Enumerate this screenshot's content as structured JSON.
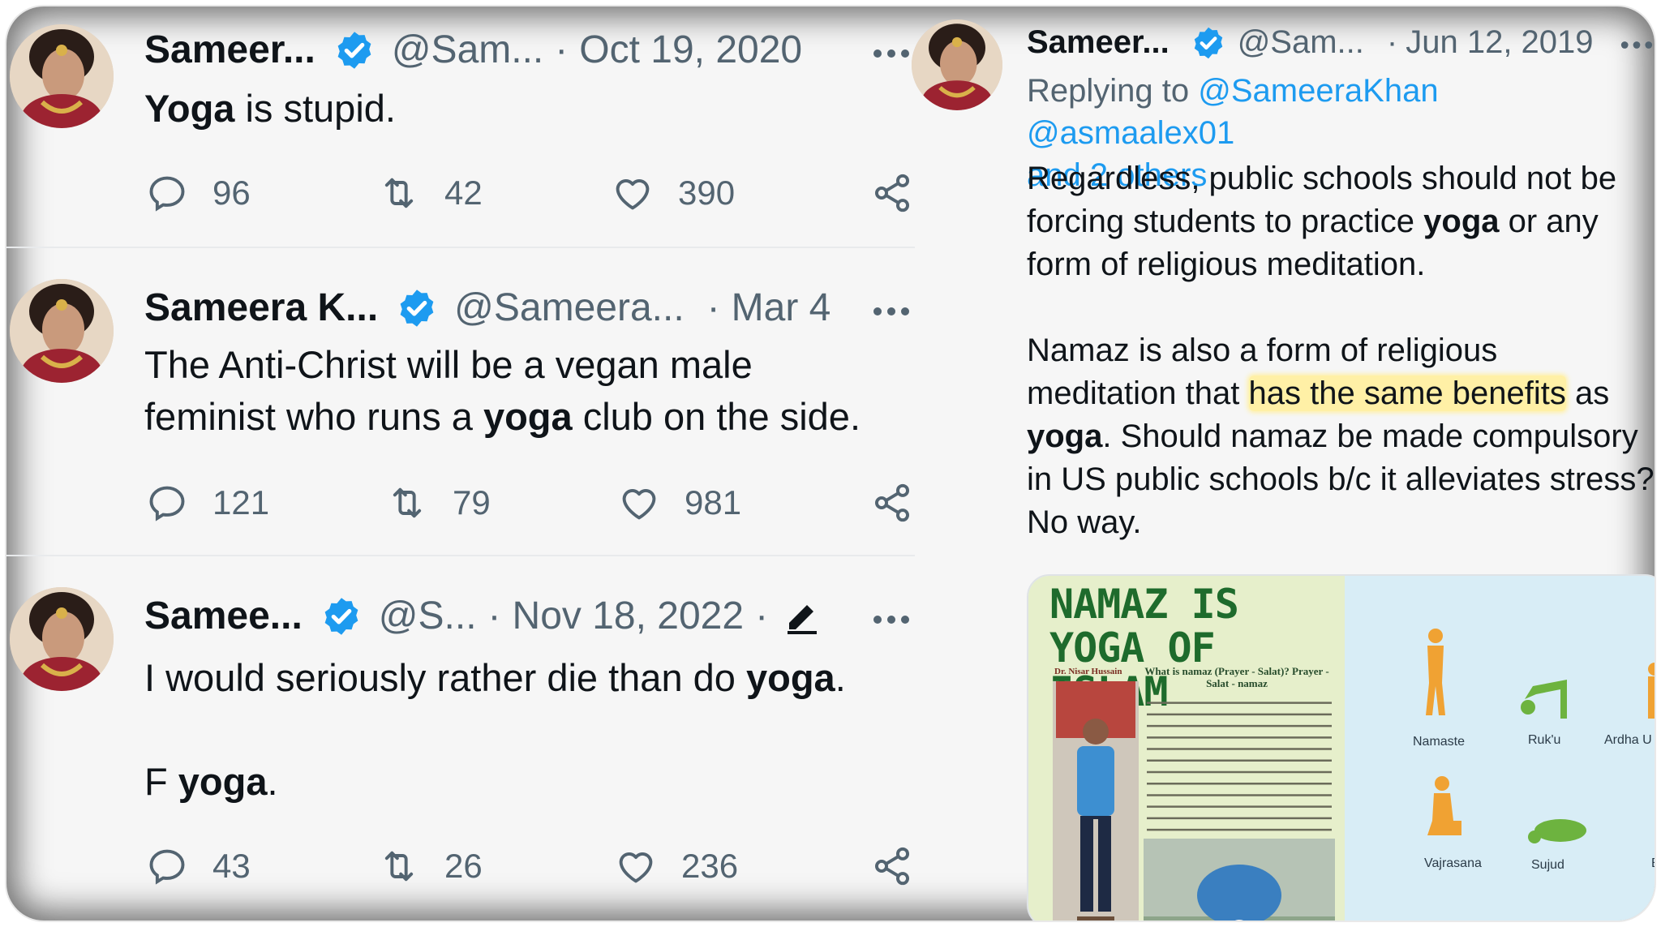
{
  "left_tweets": [
    {
      "name": "Sameer...",
      "handle": "@Sam...",
      "date": "Oct 19, 2020",
      "text_bold": "Yoga",
      "text_rest": " is stupid.",
      "replies": "96",
      "retweets": "42",
      "likes": "390"
    },
    {
      "name": "Sameera K...",
      "handle": "@Sameera...",
      "date": "Mar 4",
      "line1": "The Anti-Christ will be a vegan male",
      "line2_pre": "feminist who runs a ",
      "line2_bold": "yoga",
      "line2_post": " club on the side.",
      "replies": "121",
      "retweets": "79",
      "likes": "981"
    },
    {
      "name": "Samee...",
      "handle": "@S...",
      "date": "Nov 18, 2022",
      "line1_pre": "I would seriously rather die than do ",
      "line1_bold": "yoga",
      "line1_post": ".",
      "line2_pre": "F ",
      "line2_bold": "yoga",
      "line2_post": ".",
      "replies": "43",
      "retweets": "26",
      "likes": "236"
    }
  ],
  "right_tweet": {
    "name": "Sameer...",
    "handle": "@Sam...",
    "date": "Jun 12, 2019",
    "replying_prefix": "Replying to ",
    "mention1": "@SameeraKhan",
    "mention2": "@asmaalex01",
    "others": "and 2 others",
    "p1_l1": "Regardless, public schools should not be",
    "p1_l2_pre": "forcing students to practice ",
    "p1_l2_bold": "yoga",
    "p1_l2_post": " or any",
    "p1_l3": "form of religious meditation.",
    "p2_l1": "Namaz is also a form of religious",
    "p2_l2_pre": "meditation that ",
    "p2_l2_hl": "has the same benefits",
    "p2_l2_post": " as",
    "p2_l3_bold": "yoga",
    "p2_l3_post": ". Should namaz be made compulsory",
    "p2_l4": "in US public schools b/c it alleviates stress?",
    "p2_l5": "No way."
  },
  "media": {
    "magazine_title_1": "NAMAZ IS",
    "magazine_title_2": "YOGA OF ISLAM",
    "magazine_subtitle": "What is namaz (Prayer - Salat)? Prayer - Salat - namaz",
    "magazine_author": "Dr. Nisar Hussain",
    "pose_labels": [
      "Namaste",
      "Ruk'u",
      "Ardha U",
      "Vajrasana",
      "Sujud",
      "Ba"
    ]
  },
  "colors": {
    "accent_blue": "#1d9bf0",
    "muted_gray": "#536471",
    "highlight_yellow": "#fff0a6",
    "text_dark": "#0f1419"
  },
  "icons": [
    "verified-badge-icon",
    "more-icon",
    "reply-icon",
    "retweet-icon",
    "like-icon",
    "share-icon",
    "edit-icon"
  ]
}
